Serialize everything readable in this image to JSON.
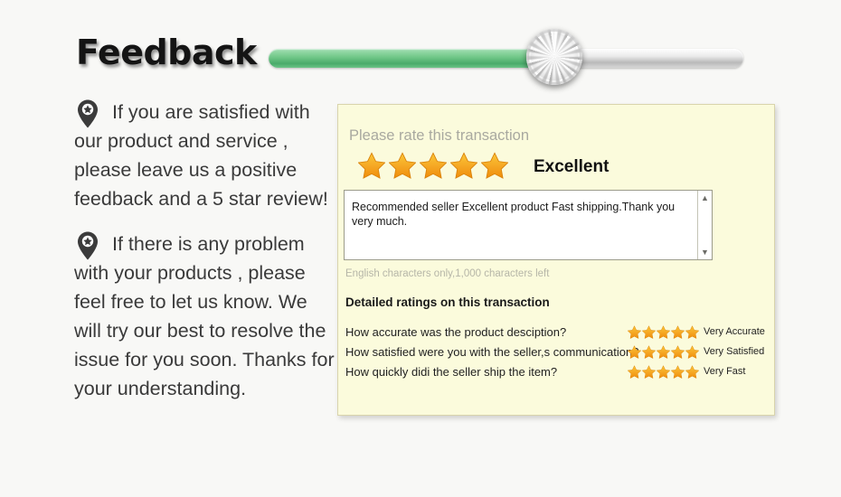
{
  "page": {
    "background_color": "#f8f8f6"
  },
  "header": {
    "title": "Feedback",
    "slider": {
      "name": "progress-slider",
      "fill_color": "#6cc488",
      "track_color": "#cfcfcf",
      "value_percent": 60
    }
  },
  "left_column": {
    "notes": [
      {
        "icon": "map-pin-star-icon",
        "text": "If you are satisfied with our product and service , please leave us a positive feedback and a 5 star review!"
      },
      {
        "icon": "map-pin-star-icon",
        "text": "If there is any problem with your products , please feel free to let us know. We will try our best to resolve the issue for you soon. Thanks for your understanding."
      }
    ]
  },
  "rating_panel": {
    "background_color": "#fbfbdc",
    "border_color": "#d9d4ac",
    "star_color": "#f5a623",
    "prompt": "Please rate this transaction",
    "overall_stars": 5,
    "overall_label": "Excellent",
    "comment": {
      "value": "Recommended seller Excellent product Fast shipping.Thank you very much.",
      "placeholder": "",
      "scroll_up_icon": "chevron-up-icon",
      "scroll_down_icon": "chevron-down-icon"
    },
    "char_note": "English characters only,1,000 characters left",
    "detailed_heading": "Detailed ratings on this transaction",
    "detailed_ratings": [
      {
        "question": "How accurate was the product desciption?",
        "stars": 5,
        "label": "Very Accurate"
      },
      {
        "question": "How satisfied were you with the seller,s communication?",
        "stars": 5,
        "label": "Very Satisfied"
      },
      {
        "question": "How quickly didi the seller ship the item?",
        "stars": 5,
        "label": "Very Fast"
      }
    ]
  }
}
